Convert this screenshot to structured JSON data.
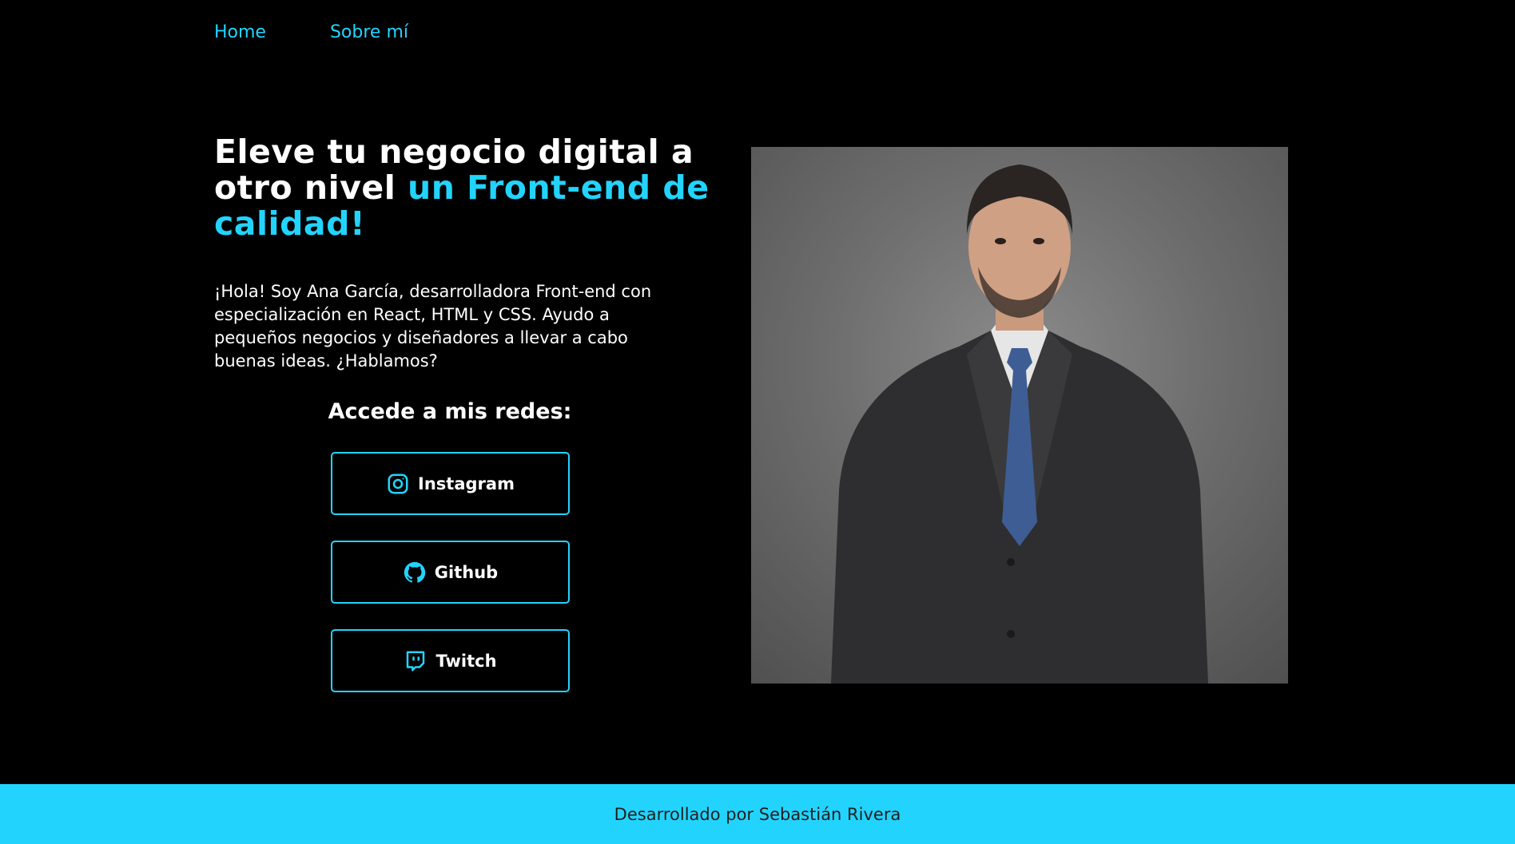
{
  "nav": {
    "items": [
      {
        "label": "Home"
      },
      {
        "label": "Sobre mí"
      }
    ]
  },
  "hero": {
    "headline_part1": "Eleve tu negocio digital a otro nivel ",
    "headline_accent": "un Front-end de calidad!",
    "intro": "¡Hola! Soy Ana García, desarrolladora Front-end con especialización en React, HTML y CSS. Ayudo a pequeños negocios y diseñadores a llevar a cabo buenas ideas. ¿Hablamos?",
    "social_title": "Accede a mis redes:",
    "social": [
      {
        "label": "Instagram",
        "icon": "instagram-icon"
      },
      {
        "label": "Github",
        "icon": "github-icon"
      },
      {
        "label": "Twitch",
        "icon": "twitch-icon"
      }
    ]
  },
  "footer": {
    "text": "Desarrollado por Sebastián Rivera"
  },
  "colors": {
    "accent": "#22d4fd",
    "background": "#000000",
    "footer_text": "#1f1f1f"
  }
}
